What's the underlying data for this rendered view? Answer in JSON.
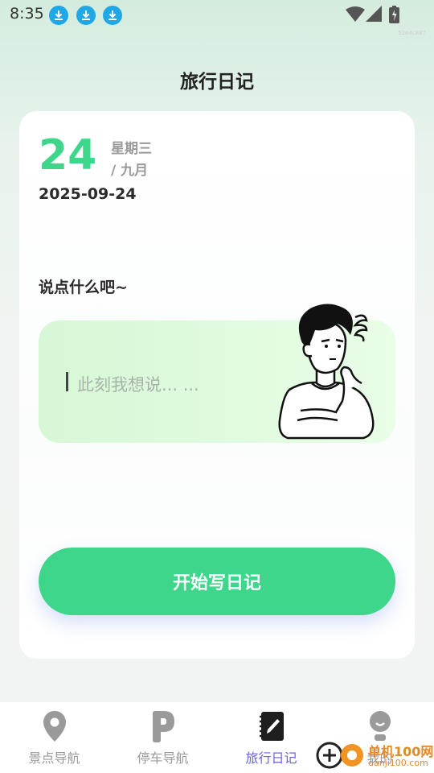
{
  "status_bar": {
    "time": "8:35",
    "notifications": [
      "download-icon",
      "download-icon",
      "download-icon"
    ],
    "system_icons": [
      "wifi-icon",
      "signal-icon",
      "battery-charging-icon"
    ],
    "tiny_text": "52e4c887"
  },
  "header": {
    "title": "旅行日记"
  },
  "date_card": {
    "day": "24",
    "weekday": "星期三",
    "month": "/ 九月",
    "full_date": "2025-09-24"
  },
  "prompt": "说点什么吧~",
  "input": {
    "placeholder": "此刻我想说... ..."
  },
  "cta": {
    "label": "开始写日记"
  },
  "tabs": [
    {
      "label": "景点导航",
      "icon": "location-pin-icon"
    },
    {
      "label": "停车导航",
      "icon": "parking-icon"
    },
    {
      "label": "旅行日记",
      "icon": "notebook-icon"
    },
    {
      "label": "我的",
      "icon": "profile-icon"
    }
  ],
  "colors": {
    "accent": "#3dd68a",
    "active_tab": "#6d63e0",
    "inactive_tab": "#9a9a9a"
  },
  "watermark": {
    "name": "单机100网",
    "url": "danji100.com"
  }
}
